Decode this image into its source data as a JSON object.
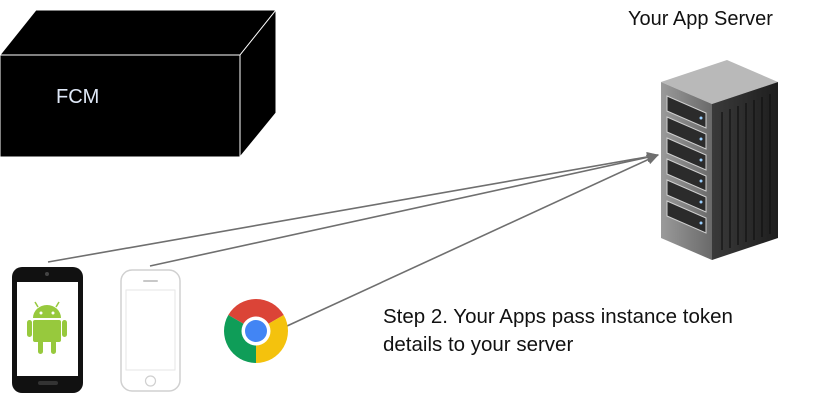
{
  "fcm": {
    "label": "FCM"
  },
  "server": {
    "title": "Your App Server"
  },
  "step": {
    "line1": "Step 2. Your Apps pass instance token",
    "line2": "details to your server"
  },
  "devices": [
    "android-phone",
    "iphone",
    "chrome-browser"
  ],
  "icons": {
    "fcm": "black-3d-box-icon",
    "server": "server-rack-icon",
    "android": "android-robot-icon",
    "iphone": "iphone-icon",
    "chrome": "chrome-logo-icon"
  },
  "colors": {
    "box": "#000000",
    "box_label": "#dfe8f7",
    "arrow": "#6f6f6f",
    "android_green": "#97c93d",
    "chrome_red": "#db4437",
    "chrome_yellow": "#f4c20d",
    "chrome_green": "#0f9d58",
    "chrome_blue": "#4285f4"
  }
}
